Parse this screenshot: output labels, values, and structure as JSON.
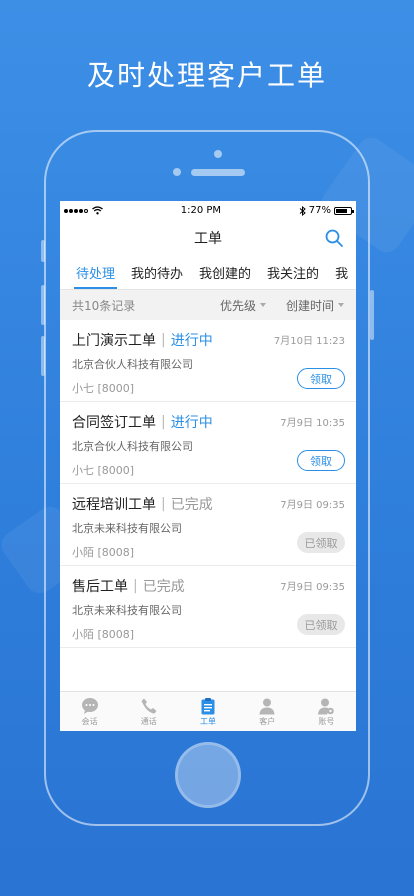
{
  "headline": "及时处理客户工单",
  "status_bar": {
    "time": "1:20 PM",
    "battery": "77%",
    "battery_level": 0.77
  },
  "nav": {
    "title": "工单",
    "search_icon": "search-icon"
  },
  "tabs": [
    {
      "label": "待处理",
      "active": true
    },
    {
      "label": "我的待办"
    },
    {
      "label": "我创建的"
    },
    {
      "label": "我关注的"
    },
    {
      "label": "我"
    }
  ],
  "filter": {
    "count": "共10条记录",
    "priority": "优先级",
    "created_time": "创建时间"
  },
  "tickets": [
    {
      "title": "上门演示工单",
      "status": "进行中",
      "status_type": "progress",
      "date": "7月10日 11:23",
      "company": "北京合伙人科技有限公司",
      "person": "小七 [8000]",
      "action": "领取",
      "action_type": "claim"
    },
    {
      "title": "合同签订工单",
      "status": "进行中",
      "status_type": "progress",
      "date": "7月9日 10:35",
      "company": "北京合伙人科技有限公司",
      "person": "小七 [8000]",
      "action": "领取",
      "action_type": "claim"
    },
    {
      "title": "远程培训工单",
      "status": "已完成",
      "status_type": "done",
      "date": "7月9日 09:35",
      "company": "北京未来科技有限公司",
      "person": "小陌 [8008]",
      "action": "已领取",
      "action_type": "claimed"
    },
    {
      "title": "售后工单",
      "status": "已完成",
      "status_type": "done",
      "date": "7月9日 09:35",
      "company": "北京未来科技有限公司",
      "person": "小陌 [8008]",
      "action": "已领取",
      "action_type": "claimed"
    }
  ],
  "tab_bar": [
    {
      "label": "会话",
      "icon": "chat-icon"
    },
    {
      "label": "通话",
      "icon": "phone-icon"
    },
    {
      "label": "工单",
      "icon": "clipboard-icon",
      "active": true
    },
    {
      "label": "客户",
      "icon": "person-icon"
    },
    {
      "label": "账号",
      "icon": "account-gear-icon"
    }
  ],
  "colors": {
    "accent": "#2b8fe6",
    "background": "#3388e2"
  }
}
